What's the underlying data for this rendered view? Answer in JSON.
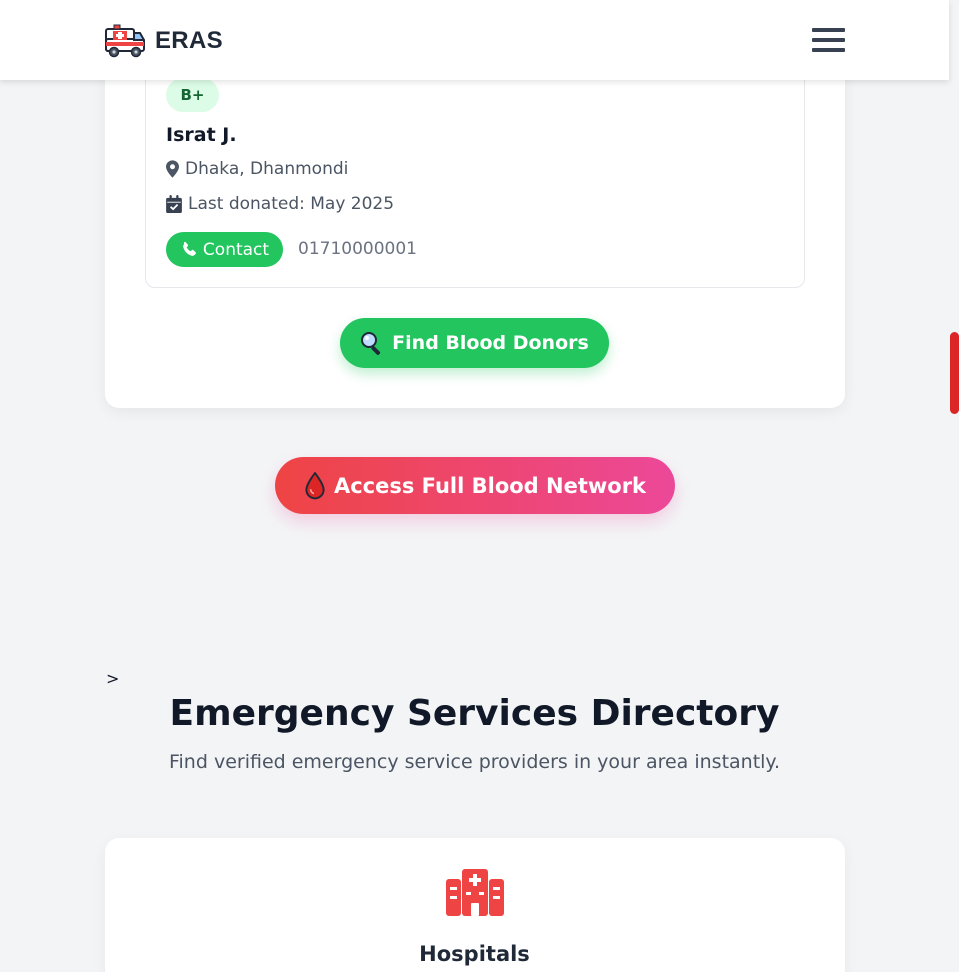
{
  "header": {
    "brand_name": "ERAS",
    "logo_icon": "ambulance-icon",
    "menu_icon": "hamburger-menu-icon"
  },
  "donor": {
    "blood_group": "B+",
    "name": "Israt J.",
    "location": "Dhaka, Dhanmondi",
    "last_donated": "Last donated: May 2025",
    "contact_label": "Contact",
    "phone": "01710000001"
  },
  "actions": {
    "find_donors_label": "Find Blood Donors",
    "full_network_label": "Access Full Blood Network"
  },
  "stray_text": ">",
  "directory": {
    "title": "Emergency Services Directory",
    "subtitle": "Find verified emergency service providers in your area instantly.",
    "services": [
      {
        "label": "Hospitals",
        "icon": "hospital-icon"
      }
    ]
  },
  "colors": {
    "accent_green": "#22c55e",
    "badge_bg": "#dcfce7",
    "badge_text": "#166534",
    "gradient_start": "#ef4444",
    "gradient_end": "#ec4899",
    "hospital_red": "#ef4444",
    "scroll_thumb": "#dc2626"
  }
}
